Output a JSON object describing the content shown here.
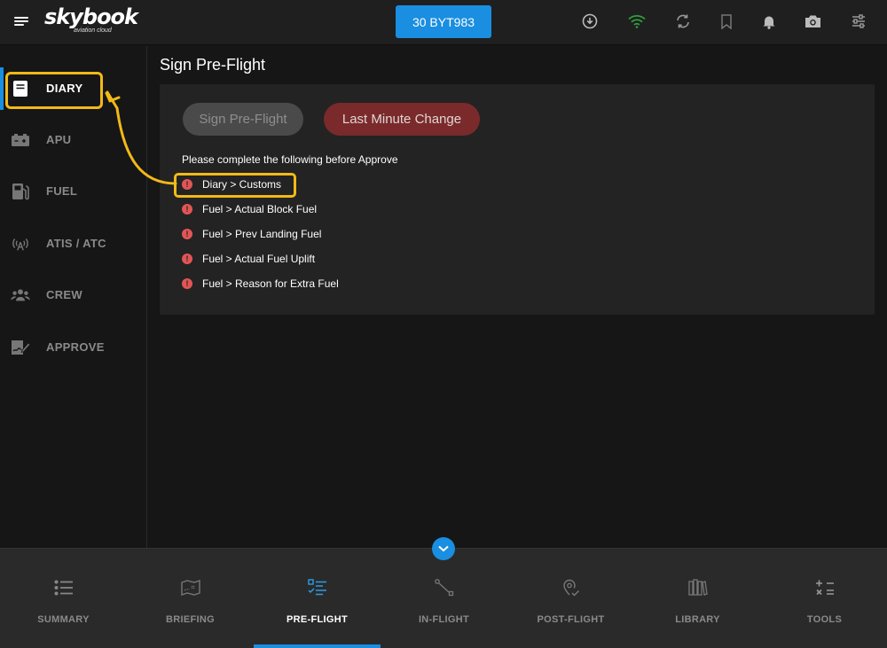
{
  "app": {
    "logo_main": "skybook",
    "logo_sub": "aviation cloud",
    "flight_id": "30 BYT983"
  },
  "topbar": {
    "icons": [
      "download-icon",
      "wifi-icon",
      "sync-icon",
      "bookmark-icon",
      "bell-icon",
      "camera-icon",
      "sliders-icon"
    ]
  },
  "sidebar": {
    "items": [
      {
        "label": "DIARY",
        "icon": "book-icon",
        "active": true
      },
      {
        "label": "APU",
        "icon": "battery-icon",
        "active": false
      },
      {
        "label": "FUEL",
        "icon": "fuel-pump-icon",
        "active": false
      },
      {
        "label": "ATIS / ATC",
        "icon": "antenna-icon",
        "active": false
      },
      {
        "label": "CREW",
        "icon": "people-icon",
        "active": false
      },
      {
        "label": "APPROVE",
        "icon": "sign-icon",
        "active": false
      }
    ]
  },
  "main": {
    "title": "Sign Pre-Flight",
    "sign_button": "Sign Pre-Flight",
    "lmc_button": "Last Minute Change",
    "instruction": "Please complete the following before Approve",
    "todo_items": [
      "Diary > Customs",
      "Fuel > Actual Block Fuel",
      "Fuel > Prev Landing Fuel",
      "Fuel > Actual Fuel Uplift",
      "Fuel > Reason for Extra Fuel"
    ],
    "warn_glyph": "!"
  },
  "bottomnav": {
    "items": [
      {
        "label": "SUMMARY",
        "icon": "list-icon",
        "active": false
      },
      {
        "label": "BRIEFING",
        "icon": "map-icon",
        "active": false
      },
      {
        "label": "PRE-FLIGHT",
        "icon": "checklist-icon",
        "active": true
      },
      {
        "label": "IN-FLIGHT",
        "icon": "route-icon",
        "active": false
      },
      {
        "label": "POST-FLIGHT",
        "icon": "location-check-icon",
        "active": false
      },
      {
        "label": "LIBRARY",
        "icon": "books-icon",
        "active": false
      },
      {
        "label": "TOOLS",
        "icon": "calculator-icon",
        "active": false
      }
    ]
  },
  "colors": {
    "accent": "#1a8ee0",
    "highlight": "#f2b918",
    "warn": "#e25555",
    "lmc": "#7a2a2a",
    "wifi": "#2e9e3e"
  }
}
